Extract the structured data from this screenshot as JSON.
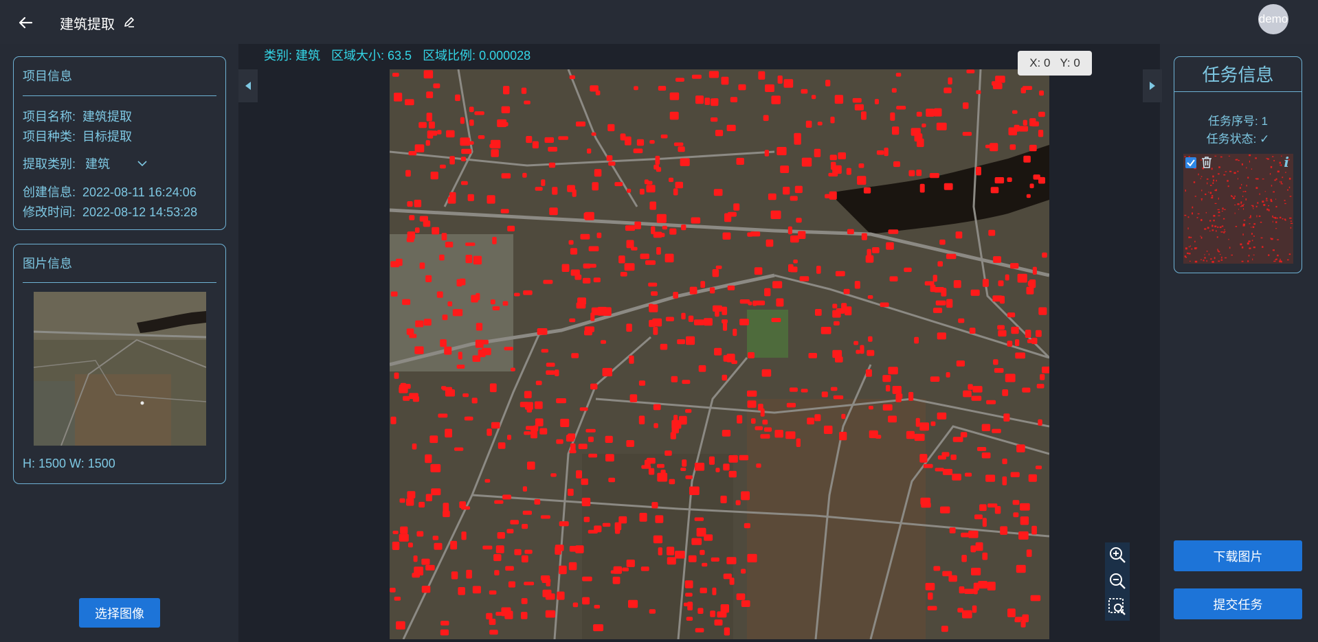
{
  "header": {
    "title": "建筑提取",
    "avatar_text": "demo"
  },
  "project_panel": {
    "title": "项目信息",
    "name_label": "项目名称:",
    "name_value": "建筑提取",
    "type_label": "项目种类:",
    "type_value": "目标提取",
    "category_label": "提取类别:",
    "category_value": "建筑",
    "created_label": "创建信息:",
    "created_value": "2022-08-11 16:24:06",
    "modified_label": "修改时间:",
    "modified_value": "2022-08-12 14:53:28"
  },
  "image_panel": {
    "title": "图片信息",
    "size_text": "H: 1500  W: 1500"
  },
  "select_image_button": "选择图像",
  "stats": {
    "category": "类别: 建筑",
    "area_size": "区域大小: 63.5",
    "area_ratio": "区域比例: 0.000028"
  },
  "coords": {
    "x": "X: 0",
    "y": "Y: 0"
  },
  "task_panel": {
    "title": "任务信息",
    "task_number": "任务序号: 1",
    "task_status": "任务状态: ✓",
    "info_glyph": "i"
  },
  "buttons": {
    "download": "下载图片",
    "submit": "提交任务"
  },
  "colors": {
    "background": "#262b35",
    "accent_text": "#7ec8e3",
    "stats_text": "#34d7e8",
    "primary_button": "#1d74d8",
    "building_overlay": "#ff1a1a"
  }
}
